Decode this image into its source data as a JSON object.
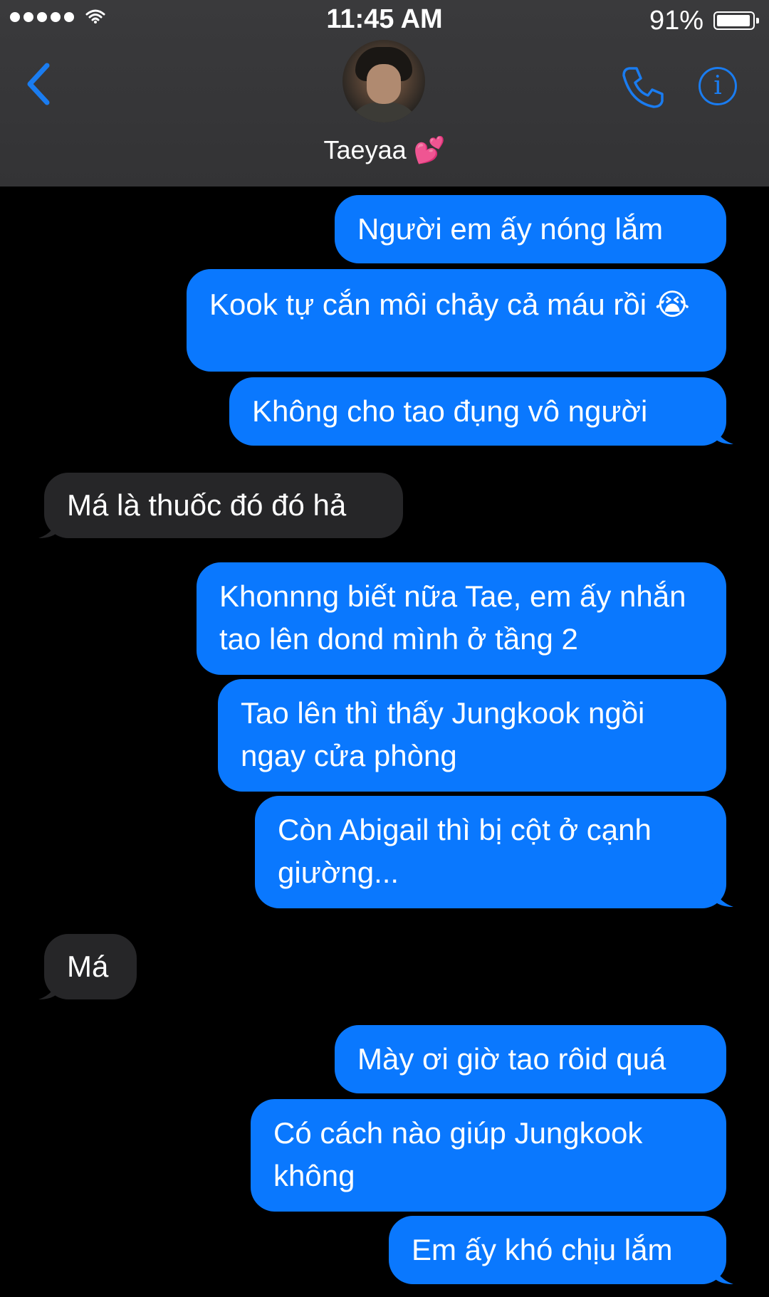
{
  "status_bar": {
    "time": "11:45 AM",
    "battery": "91%"
  },
  "header": {
    "contact_name": "Taeyaa 💕"
  },
  "messages": [
    {
      "from": "me",
      "text": "Người em ấy nóng lắm"
    },
    {
      "from": "me",
      "text": "Kook tự cắn môi chảy cả máu rồi 😭"
    },
    {
      "from": "me",
      "text": "Không cho tao đụng vô người"
    },
    {
      "from": "them",
      "text": "Má là thuốc đó đó hả"
    },
    {
      "from": "me",
      "text": "Khonnng biết nữa Tae, em ấy nhắn tao lên dond mình ở tầng 2"
    },
    {
      "from": "me",
      "text": "Tao lên thì thấy Jungkook ngồi ngay cửa phòng"
    },
    {
      "from": "me",
      "text": "Còn Abigail thì bị cột ở cạnh giường..."
    },
    {
      "from": "them",
      "text": "Má"
    },
    {
      "from": "me",
      "text": "Mày ơi giờ tao rôid quá"
    },
    {
      "from": "me",
      "text": "Có cách nào giúp Jungkook không"
    },
    {
      "from": "me",
      "text": "Em ấy khó chịu lắm"
    }
  ],
  "colors": {
    "sent_bubble": "#0a78fe",
    "received_bubble": "#262628",
    "accent": "#1a7cf0"
  },
  "icons": [
    "back-chevron-icon",
    "phone-icon",
    "info-icon",
    "wifi-icon",
    "battery-icon"
  ]
}
